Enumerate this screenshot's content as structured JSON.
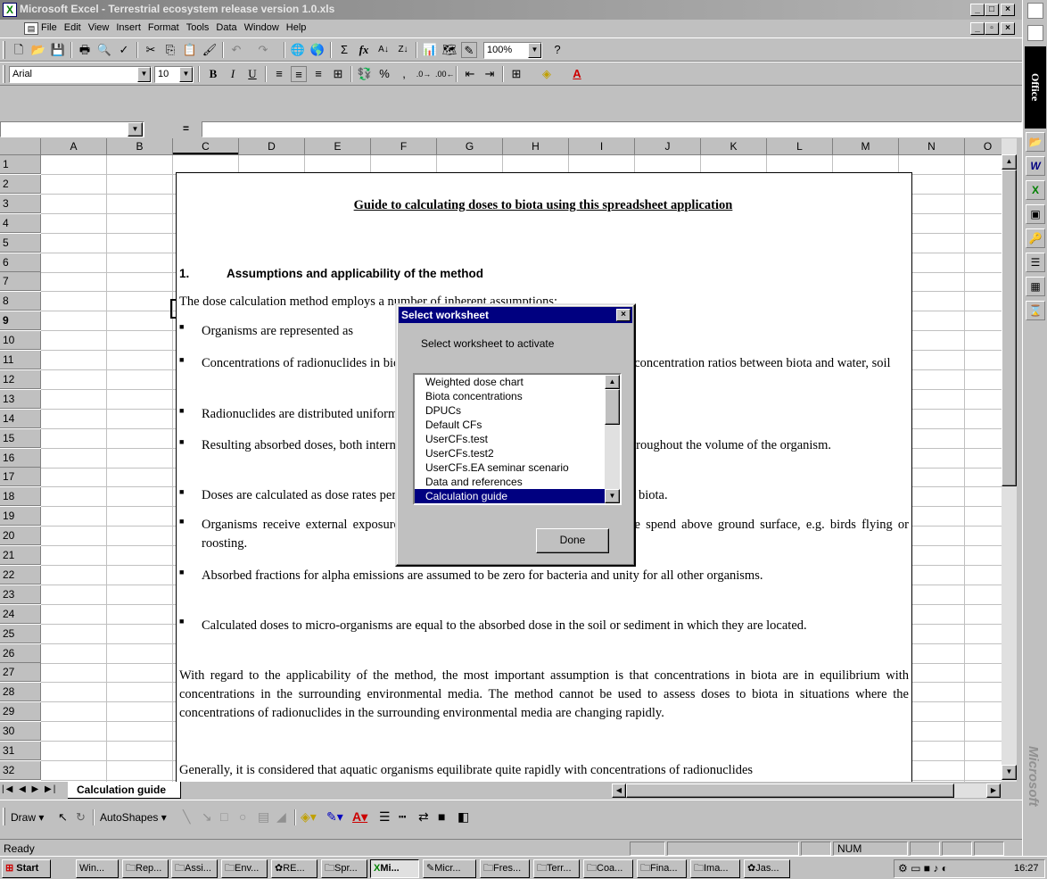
{
  "window": {
    "title": "Microsoft Excel - Terrestrial ecosystem release version 1.0.xls",
    "app_icon": "excel-icon",
    "controls": [
      "_",
      "□",
      "×"
    ]
  },
  "menu": {
    "items": [
      "File",
      "Edit",
      "View",
      "Insert",
      "Format",
      "Tools",
      "Data",
      "Window",
      "Help"
    ]
  },
  "toolbar": {
    "zoom": "100%",
    "font_name": "Arial",
    "font_size": "10",
    "sigma": "Σ",
    "fx": "fx",
    "percent": "%",
    "comma": ",",
    "bold": "B",
    "italic": "I",
    "underline": "U",
    "font_color_letter": "A"
  },
  "formula_bar": {
    "name_box": "",
    "equals": "=",
    "content": ""
  },
  "grid": {
    "columns": [
      "A",
      "B",
      "C",
      "D",
      "E",
      "F",
      "G",
      "H",
      "I",
      "J",
      "K",
      "L",
      "M",
      "N",
      "O"
    ],
    "rows": [
      "1",
      "2",
      "3",
      "4",
      "5",
      "6",
      "7",
      "8",
      "9",
      "10",
      "11",
      "12",
      "13",
      "14",
      "15",
      "16",
      "17",
      "18",
      "19",
      "20",
      "21",
      "22",
      "23",
      "24",
      "25",
      "26",
      "27",
      "28",
      "29",
      "30",
      "31",
      "32"
    ],
    "selected_column": "C",
    "selected_row": "9"
  },
  "textbox": {
    "heading": "Guide to calculating doses to biota using this spreadsheet application",
    "section_number": "1.",
    "section_title": "Assumptions and applicability of the method",
    "intro": "The dose calculation method employs a number of inherent assumptions:",
    "bullet_mark": "■",
    "bullets": [
      "Organisms are represented as",
      "Concentrations of radionuclides in biota can be estimated using simple equilibrium concentration ratios between biota and water, soil",
      "Radionuclides are distributed uniformly throughout the whole animal or plant.",
      "Resulting absorbed doses, both internal and external, are calculated as an average throughout the volume of the organism.",
      "Doses are calculated as dose rates per unit activity concentration of radionuclides in biota.",
      "Organisms receive external exposure taking account of the fraction of their time spend above ground surface, e.g. birds flying or roosting.",
      "Absorbed fractions for alpha emissions are assumed to be zero for bacteria and unity for all other organisms.",
      "Calculated doses to micro-organisms are equal to the absorbed dose in the soil or sediment in which they are located."
    ],
    "para1": "With regard to the applicability of the method, the most important assumption is that concentrations in biota are in equilibrium with concentrations in the surrounding environmental media. The method cannot be used to assess doses to biota in situations where the concentrations of radionuclides in the surrounding environmental media are changing rapidly.",
    "para2": "Generally, it is considered that aquatic organisms equilibrate quite rapidly with concentrations of radionuclides"
  },
  "dialog": {
    "title": "Select worksheet",
    "close": "×",
    "prompt": "Select worksheet to activate",
    "items": [
      "Weighted dose chart",
      "Biota concentrations",
      "DPUCs",
      "Default CFs",
      "UserCFs.test",
      "UserCFs.test2",
      "UserCFs.EA seminar scenario",
      "Data and references",
      "Calculation guide"
    ],
    "selected": "Calculation guide",
    "done_label": "Done"
  },
  "sheet_tab": {
    "label": "Calculation guide"
  },
  "drawing_toolbar": {
    "draw_label": "Draw",
    "autoshapes_label": "AutoShapes"
  },
  "status": {
    "ready": "Ready",
    "num": "NUM"
  },
  "office_bar": {
    "label": "Office",
    "brand": "Microsoft"
  },
  "taskbar": {
    "start": "Start",
    "tasks": [
      "Win...",
      "Rep...",
      "Assi...",
      "Env...",
      "RE...",
      "Spr...",
      "Mi...",
      "Micr...",
      "Fres...",
      "Terr...",
      "Coa...",
      "Fina...",
      "Ima...",
      "Jas..."
    ],
    "active_task": "Mi...",
    "clock": "16:27"
  }
}
